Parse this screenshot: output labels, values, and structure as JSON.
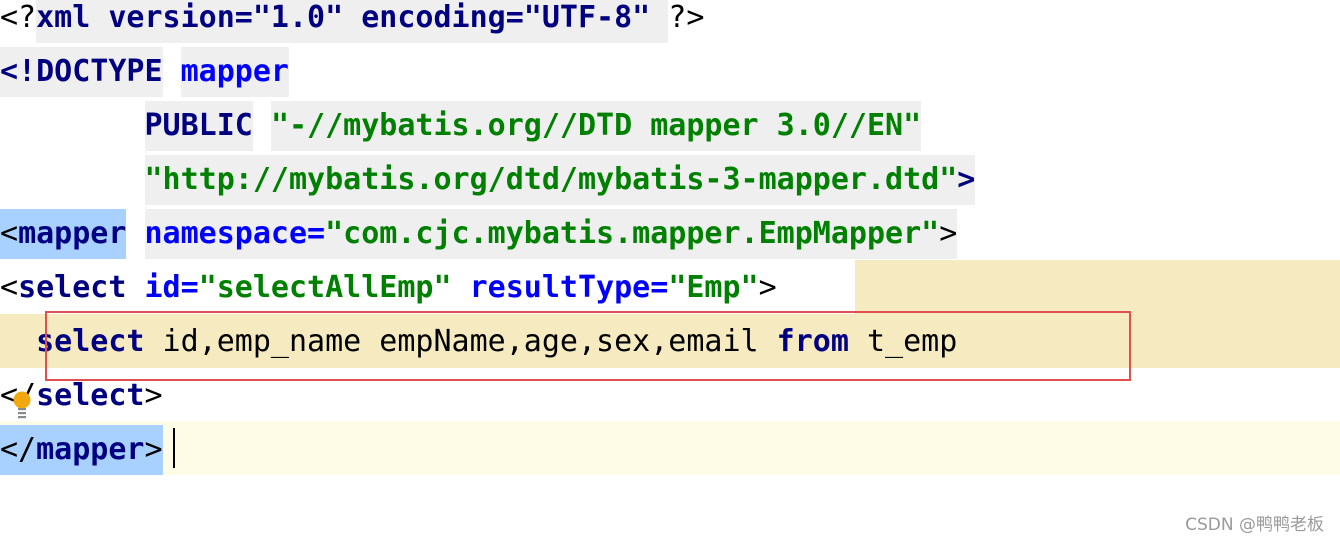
{
  "editor": {
    "lines": [
      {
        "prolog_open": "<?",
        "decl": "xml version=\"1.0\" encoding=\"UTF-8\" ",
        "prolog_close": "?>"
      },
      {
        "open": "<!DOCTYPE",
        "name": "mapper"
      },
      {
        "public_kw": "PUBLIC",
        "public_id": "\"-//mybatis.org//DTD mapper 3.0//EN\""
      },
      {
        "system_id": "\"http://mybatis.org/dtd/mybatis-3-mapper.dtd\"",
        "close": ">"
      },
      {
        "open": "<",
        "tag": "mapper",
        "attr": "namespace=",
        "value": "\"com.cjc.mybatis.mapper.EmpMapper\"",
        "close": ">"
      },
      {
        "open": "<",
        "tag": "select",
        "attr1": "id=",
        "value1": "\"selectAllEmp\"",
        "attr2": "resultType=",
        "value2": "\"Emp\"",
        "close": ">"
      },
      {
        "kw_select": "select",
        "columns": " id,emp_name empName,age,sex,email ",
        "kw_from": "from",
        "table": " t_emp"
      },
      {
        "open": "</",
        "tag": "select",
        "close": ">"
      },
      {
        "open": "</",
        "tag": "mapper",
        "close": ">"
      }
    ]
  },
  "watermark": "CSDN @鸭鸭老板",
  "icons": {
    "intention_bulb": "lightbulb-icon"
  },
  "colors": {
    "tag": "#000080",
    "attribute": "#0000ff",
    "string": "#008000",
    "selection": "#a8d1ff",
    "sql_band": "#f5eac0",
    "current_line": "#fefbe6",
    "highlight_box": "#e05050"
  }
}
